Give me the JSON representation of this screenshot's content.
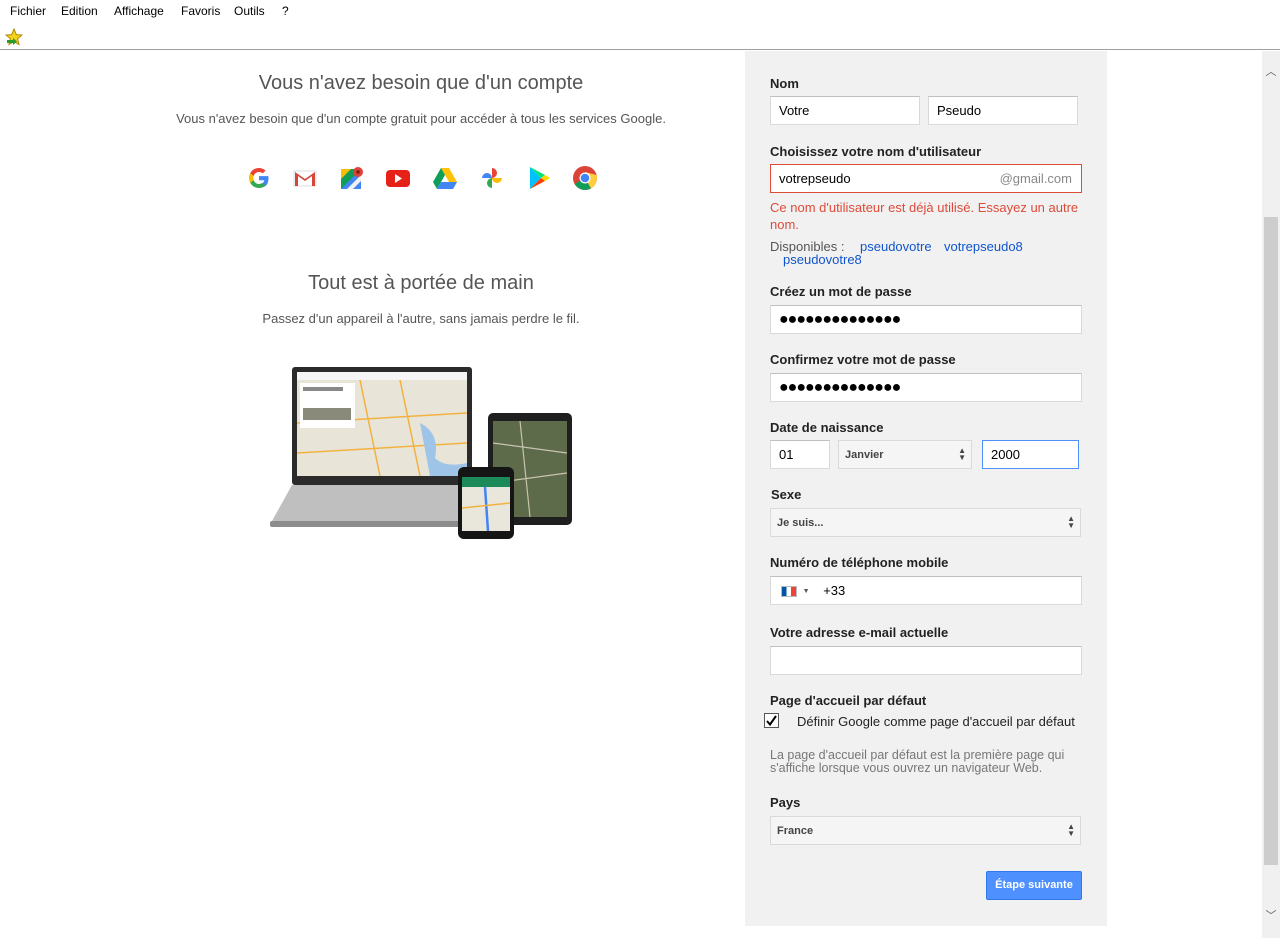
{
  "menu": [
    "Fichier",
    "Edition",
    "Affichage",
    "Favoris",
    "Outils",
    "?"
  ],
  "intro": {
    "title": "Vous n'avez besoin que d'un compte",
    "subtitle": "Vous n'avez besoin que d'un compte gratuit pour accéder à tous les services Google.",
    "services": [
      "google-icon",
      "gmail-icon",
      "maps-icon",
      "youtube-icon",
      "drive-icon",
      "photos-icon",
      "play-icon",
      "chrome-icon"
    ]
  },
  "devices": {
    "title": "Tout est à portée de main",
    "subtitle": "Passez d'un appareil à l'autre, sans jamais perdre le fil."
  },
  "form": {
    "name_label": "Nom",
    "first_name": "Votre",
    "last_name": "Pseudo",
    "username_label": "Choisissez votre nom d'utilisateur",
    "username": "votrepseudo",
    "username_suffix": "@gmail.com",
    "username_error": "Ce nom d'utilisateur est déjà utilisé. Essayez un autre nom.",
    "available_label": "Disponibles :",
    "suggestions": [
      "pseudovotre",
      "votrepseudo8",
      "pseudovotre8"
    ],
    "password_label": "Créez un mot de passe",
    "password_mask": "●●●●●●●●●●●●●●",
    "confirm_label": "Confirmez votre mot de passe",
    "confirm_mask": "●●●●●●●●●●●●●●",
    "birth_label": "Date de naissance",
    "birth_day": "01",
    "birth_month": "Janvier",
    "birth_year": "2000",
    "gender_label": "Sexe",
    "gender_value": "Je suis...",
    "phone_label": "Numéro de téléphone mobile",
    "phone_prefix": "+33",
    "email_label": "Votre adresse e-mail actuelle",
    "email_value": "",
    "homepage_label": "Page d'accueil par défaut",
    "homepage_checkbox": "Définir Google comme page d'accueil par défaut",
    "homepage_checked": true,
    "homepage_help": "La page d'accueil par défaut est la première page qui s'affiche lorsque vous ouvrez un navigateur Web.",
    "country_label": "Pays",
    "country_value": "France",
    "next_button": "Étape suivante"
  },
  "colors": {
    "accent": "#4d90fe",
    "error": "#dd4b39",
    "link": "#1155cc",
    "panel": "#f1f1f1"
  }
}
